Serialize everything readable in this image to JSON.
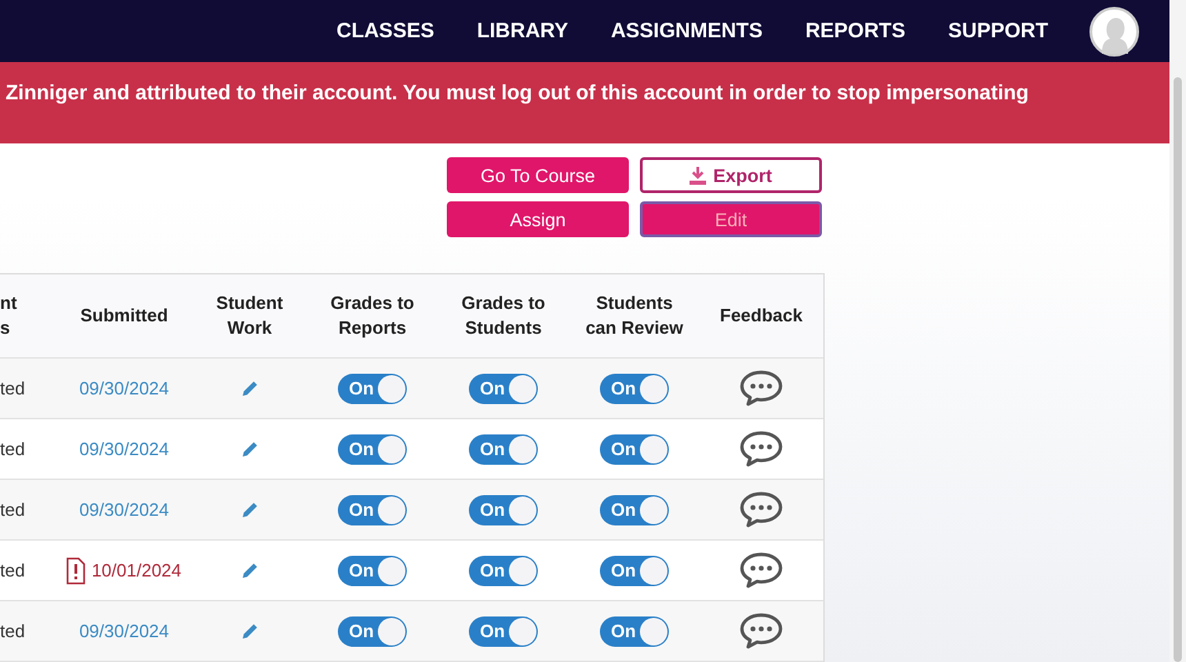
{
  "nav": {
    "items": [
      {
        "label": "CLASSES"
      },
      {
        "label": "LIBRARY"
      },
      {
        "label": "ASSIGNMENTS"
      },
      {
        "label": "REPORTS"
      },
      {
        "label": "SUPPORT"
      }
    ]
  },
  "banner": {
    "text": "Zinniger and attributed to their account. You must log out of this account in order to stop impersonating"
  },
  "actions": [
    {
      "label": "Go To Course",
      "kind": "filled",
      "selected": false
    },
    {
      "label": "Export",
      "kind": "outline",
      "selected": false
    },
    {
      "label": "Assign",
      "kind": "filled",
      "selected": false
    },
    {
      "label": "Edit",
      "kind": "filled",
      "selected": true
    }
  ],
  "table": {
    "columns": [
      {
        "lines": [
          "nt",
          "s"
        ]
      },
      {
        "lines": [
          "Submitted"
        ]
      },
      {
        "lines": [
          "Student",
          "Work"
        ]
      },
      {
        "lines": [
          "Grades to",
          "Reports"
        ]
      },
      {
        "lines": [
          "Grades to",
          "Students"
        ]
      },
      {
        "lines": [
          "Students",
          "can Review"
        ]
      },
      {
        "lines": [
          "Feedback"
        ]
      }
    ],
    "rows": [
      {
        "column_1": "ted",
        "submitted": "09/30/2024",
        "late": false,
        "toggles": [
          {
            "label": "On",
            "on": true
          },
          {
            "label": "On",
            "on": true
          },
          {
            "label": "On",
            "on": true
          }
        ]
      },
      {
        "column_1": "ted",
        "submitted": "09/30/2024",
        "late": false,
        "toggles": [
          {
            "label": "On",
            "on": true
          },
          {
            "label": "On",
            "on": true
          },
          {
            "label": "On",
            "on": true
          }
        ]
      },
      {
        "column_1": "ted",
        "submitted": "09/30/2024",
        "late": false,
        "toggles": [
          {
            "label": "On",
            "on": true
          },
          {
            "label": "On",
            "on": true
          },
          {
            "label": "On",
            "on": true
          }
        ]
      },
      {
        "column_1": "ted",
        "submitted": "10/01/2024",
        "late": true,
        "toggles": [
          {
            "label": "On",
            "on": true
          },
          {
            "label": "On",
            "on": true
          },
          {
            "label": "On",
            "on": true
          }
        ]
      },
      {
        "column_1": "ted",
        "submitted": "09/30/2024",
        "late": false,
        "toggles": [
          {
            "label": "On",
            "on": true
          },
          {
            "label": "On",
            "on": true
          },
          {
            "label": "On",
            "on": true
          }
        ]
      }
    ]
  }
}
